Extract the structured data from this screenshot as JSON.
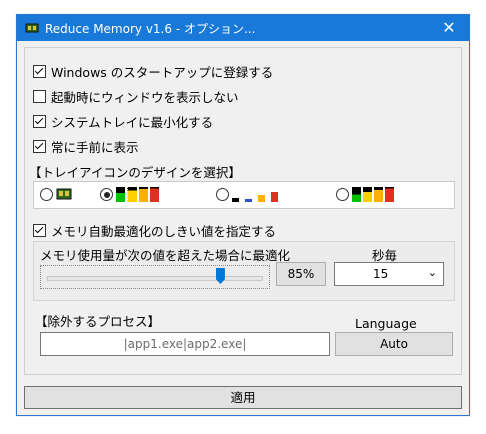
{
  "window": {
    "title": "Reduce Memory v1.6 - オプション...",
    "close_glyph": "✕"
  },
  "options": [
    {
      "label": "Windows のスタートアップに登録する",
      "checked": true
    },
    {
      "label": "起動時にウィンドウを表示しない",
      "checked": false
    },
    {
      "label": "システムトレイに最小化する",
      "checked": true
    },
    {
      "label": "常に手前に表示",
      "checked": true
    }
  ],
  "tray_section": {
    "label": "【トレイアイコンのデザインを選択】",
    "selected_index": 1
  },
  "auto_optimize": {
    "label": "メモリ自動最適化のしきい値を指定する",
    "checked": true,
    "threshold_label": "メモリ使用量が次の値を超えた場合に最適化",
    "threshold_value": "85%",
    "threshold_fraction": 0.82,
    "interval_label": "秒毎",
    "interval_value": "15"
  },
  "exclude": {
    "label": "【除外するプロセス】",
    "value": "|app1.exe|app2.exe|"
  },
  "language": {
    "label": "Language",
    "value": "Auto"
  },
  "apply_label": "適用",
  "colors": {
    "titlebar": "#1879d8",
    "accent": "#0078d7"
  }
}
